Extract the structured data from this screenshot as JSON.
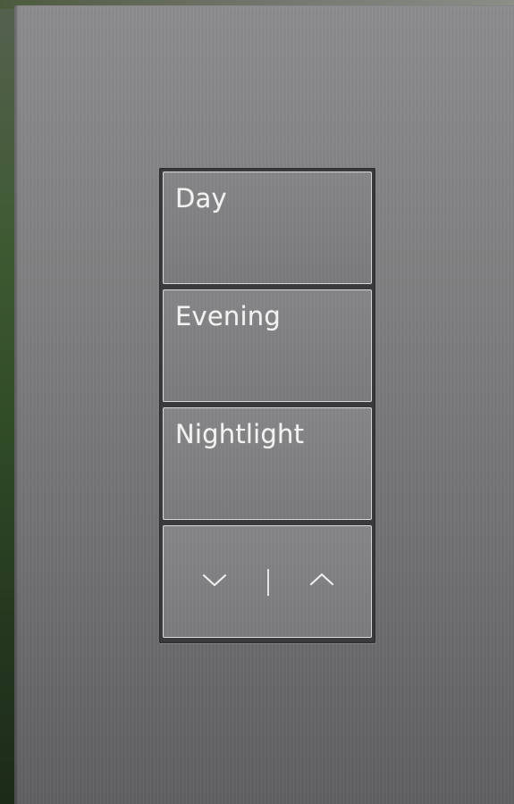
{
  "keypad": {
    "scenes": [
      {
        "label": "Day"
      },
      {
        "label": "Evening"
      },
      {
        "label": "Nightlight"
      }
    ],
    "raise_lower": {
      "lower_icon": "chevron-down-icon",
      "raise_icon": "chevron-up-icon"
    }
  },
  "colors": {
    "faceplate": "#7f7e80",
    "button_border": "#d8d8da",
    "engraving": "#f2f2f2"
  }
}
